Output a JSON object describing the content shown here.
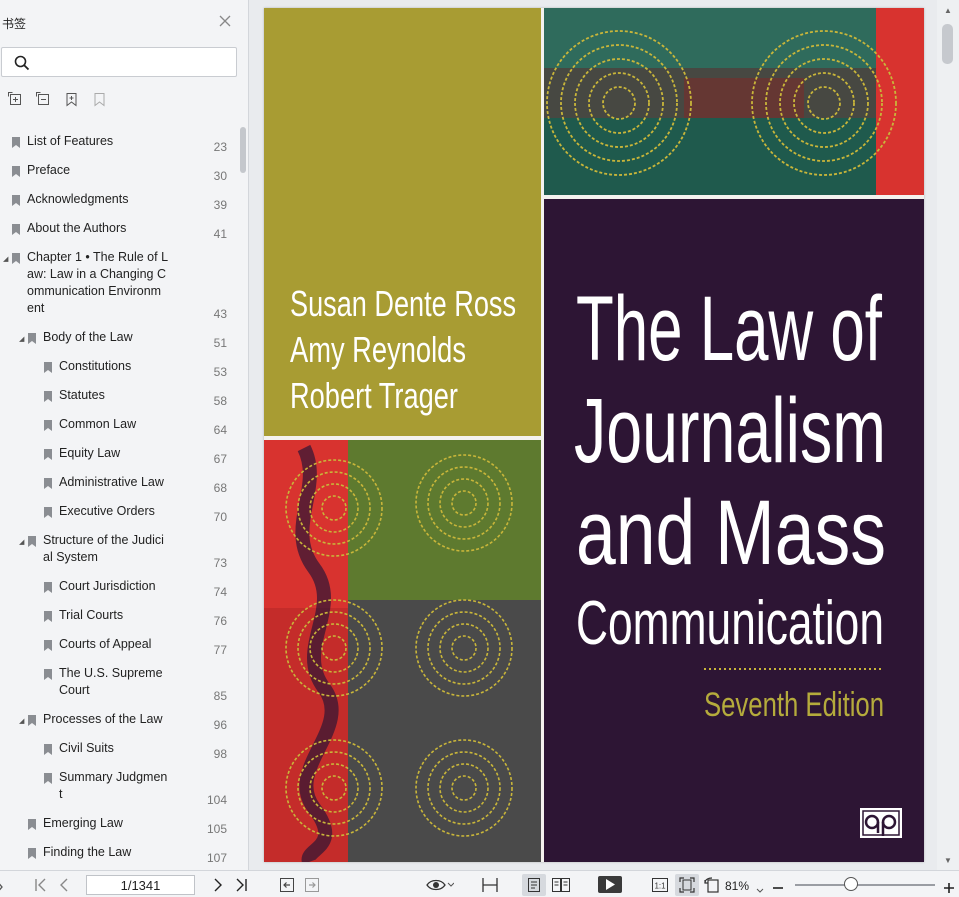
{
  "sidebar": {
    "title": "书签",
    "search_placeholder": "",
    "toc": [
      {
        "label": "List of Features",
        "page": "23",
        "level": 0,
        "expanded": null
      },
      {
        "label": "Preface",
        "page": "30",
        "level": 0,
        "expanded": null
      },
      {
        "label": "Acknowledgments",
        "page": "39",
        "level": 0,
        "expanded": null
      },
      {
        "label": "About the Authors",
        "page": "41",
        "level": 0,
        "expanded": null
      },
      {
        "label": "Chapter 1 • The Rule of L\naw: Law in a Changing C\nommunication Environm\nent",
        "page": "43",
        "level": 0,
        "expanded": true
      },
      {
        "label": "Body of the Law",
        "page": "51",
        "level": 1,
        "expanded": true
      },
      {
        "label": "Constitutions",
        "page": "53",
        "level": 2,
        "expanded": null
      },
      {
        "label": "Statutes",
        "page": "58",
        "level": 2,
        "expanded": null
      },
      {
        "label": "Common Law",
        "page": "64",
        "level": 2,
        "expanded": null
      },
      {
        "label": "Equity Law",
        "page": "67",
        "level": 2,
        "expanded": null
      },
      {
        "label": "Administrative Law",
        "page": "68",
        "level": 2,
        "expanded": null
      },
      {
        "label": "Executive Orders",
        "page": "70",
        "level": 2,
        "expanded": null
      },
      {
        "label": "Structure of the Judici\nal System",
        "page": "73",
        "level": 1,
        "expanded": true
      },
      {
        "label": "Court Jurisdiction",
        "page": "74",
        "level": 2,
        "expanded": null
      },
      {
        "label": "Trial Courts",
        "page": "76",
        "level": 2,
        "expanded": null
      },
      {
        "label": "Courts of Appeal",
        "page": "77",
        "level": 2,
        "expanded": null
      },
      {
        "label": "The U.S. Supreme\nCourt",
        "page": "85",
        "level": 2,
        "expanded": null
      },
      {
        "label": "Processes of the Law",
        "page": "96",
        "level": 1,
        "expanded": true
      },
      {
        "label": "Civil Suits",
        "page": "98",
        "level": 2,
        "expanded": null
      },
      {
        "label": "Summary Judgmen\nt",
        "page": "104",
        "level": 2,
        "expanded": null
      },
      {
        "label": "Emerging Law",
        "page": "105",
        "level": 1,
        "expanded": null
      },
      {
        "label": "Finding the Law",
        "page": "107",
        "level": 1,
        "expanded": null
      }
    ]
  },
  "cover": {
    "authors": [
      "Susan Dente Ross",
      "Amy Reynolds",
      "Robert Trager"
    ],
    "title_lines": [
      "The Law of",
      "Journalism",
      "and Mass",
      "Communication"
    ],
    "edition": "Seventh Edition",
    "colors": {
      "olive": "#a89c33",
      "plum": "#2d1534",
      "edition": "#b5ab3c",
      "red": "#d8332f",
      "teal": "#2f6b5c",
      "green": "#5e7a2f",
      "gray": "#4a4a4a"
    }
  },
  "toolbar": {
    "page_display": "1/1341",
    "zoom": "81%",
    "zoom_fraction": 0.4
  }
}
